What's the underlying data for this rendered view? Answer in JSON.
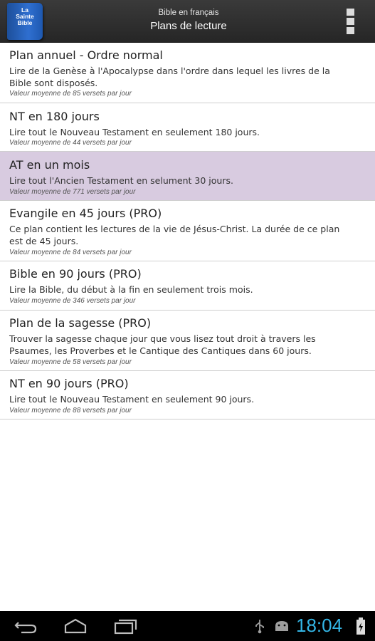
{
  "header": {
    "app_icon": "la-sainte-bible-book-icon",
    "app_icon_text": "La\nSainte\nBible",
    "subtitle": "Bible en français",
    "title": "Plans de lecture",
    "menu_icon": "overflow-menu-icon"
  },
  "plans": [
    {
      "title": "Plan annuel - Ordre normal",
      "description": "Lire de la Genèse à l'Apocalypse dans l'ordre dans lequel les livres de la Bible sont disposés.",
      "average": "Valeur moyenne de 85 versets par jour",
      "selected": false
    },
    {
      "title": "NT en 180 jours",
      "description": "Lire tout le Nouveau Testament en seulement 180 jours.",
      "average": "Valeur moyenne de 44 versets par jour",
      "selected": false
    },
    {
      "title": "AT en un mois",
      "description": "Lire tout l'Ancien Testament en selument 30 jours.",
      "average": "Valeur moyenne de 771 versets par jour",
      "selected": true
    },
    {
      "title": "Evangile en 45 jours (PRO)",
      "description": "Ce plan contient les lectures de la vie de Jésus-Christ. La durée de ce plan est de 45 jours.",
      "average": "Valeur moyenne de 84 versets par jour",
      "selected": false
    },
    {
      "title": "Bible en 90 jours (PRO)",
      "description": "Lire la Bible, du début à la fin en seulement trois mois.",
      "average": "Valeur moyenne de 346 versets par jour",
      "selected": false
    },
    {
      "title": "Plan de la sagesse (PRO)",
      "description": "Trouver la sagesse chaque jour que vous lisez tout droit à travers les Psaumes, les Proverbes et le Cantique des Cantiques dans 60 jours.",
      "average": "Valeur moyenne de 58 versets par jour",
      "selected": false
    },
    {
      "title": "NT en 90 jours (PRO)",
      "description": "Lire tout le Nouveau Testament en seulement 90 jours.",
      "average": "Valeur moyenne de 88 versets par jour",
      "selected": false
    }
  ],
  "nav_bar": {
    "back_icon": "back-icon",
    "home_icon": "home-icon",
    "recents_icon": "recent-apps-icon"
  },
  "status_bar": {
    "usb_icon": "usb-icon",
    "android_icon": "android-debug-icon",
    "time": "18:04",
    "battery_icon": "battery-charging-icon"
  },
  "colors": {
    "action_bar": "#2e2e2e",
    "selected_row": "#d8cbe0",
    "clock": "#33b5e5"
  }
}
